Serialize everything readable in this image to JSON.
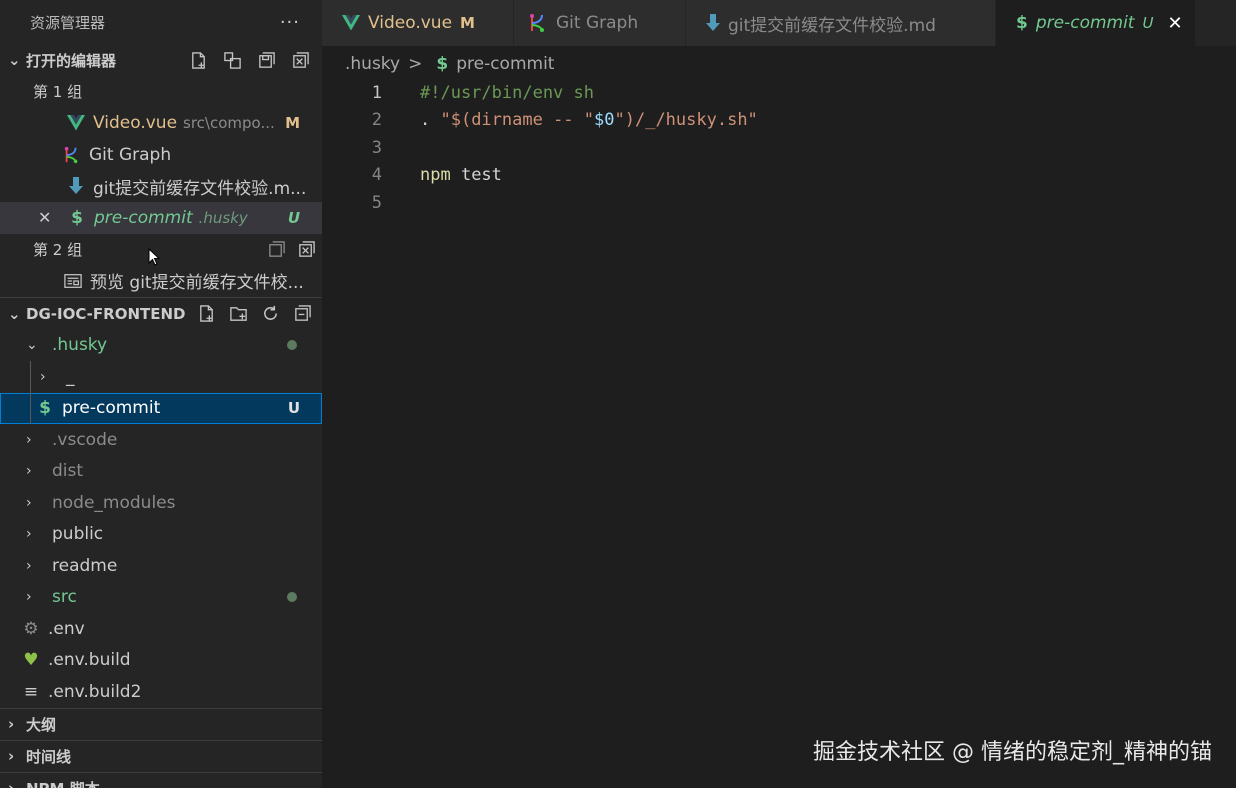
{
  "sidebar": {
    "title": "资源管理器",
    "more": "···",
    "open_editors": {
      "header": "打开的编辑器",
      "group1_label": "第 1 组",
      "group2_label": "第 2 组",
      "items": [
        {
          "label": "Video.vue",
          "desc": "src\\compo...",
          "badge": "M"
        },
        {
          "label": "Git Graph"
        },
        {
          "label": "git提交前缓存文件校验.m..."
        },
        {
          "label": "pre-commit",
          "desc": ".husky",
          "badge": "U",
          "close": "✕"
        }
      ],
      "group2_items": [
        {
          "label": "预览 git提交前缓存文件校..."
        }
      ]
    },
    "project": {
      "header": "DG-IOC-FRONTEND",
      "tree": [
        {
          "label": ".husky"
        },
        {
          "label": "_"
        },
        {
          "label": "pre-commit",
          "badge": "U"
        },
        {
          "label": ".vscode"
        },
        {
          "label": "dist"
        },
        {
          "label": "node_modules"
        },
        {
          "label": "public"
        },
        {
          "label": "readme"
        },
        {
          "label": "src"
        },
        {
          "label": ".env"
        },
        {
          "label": ".env.build"
        },
        {
          "label": ".env.build2"
        }
      ]
    },
    "outline": "大纲",
    "timeline": "时间线",
    "npm": "NPM 脚本"
  },
  "tabs": [
    {
      "label": "Video.vue",
      "mod": "M"
    },
    {
      "label": "Git Graph"
    },
    {
      "label": "git提交前缓存文件校验.md"
    },
    {
      "label": "pre-commit",
      "mod": "U",
      "close": "✕"
    }
  ],
  "breadcrumb": {
    "folder": ".husky",
    "sep": ">",
    "file": "pre-commit",
    "dollar": "$"
  },
  "editor": {
    "line_numbers": [
      "1",
      "2",
      "3",
      "4",
      "5"
    ],
    "line1": "#!/usr/bin/env sh",
    "line2_a": ". ",
    "line2_b": "\"$(dirname -- \"",
    "line2_c": "$0",
    "line2_d": "\")/_/husky.sh\"",
    "line4_a": "npm ",
    "line4_b": "test"
  },
  "watermark": "掘金技术社区 @ 情绪的稳定剂_精神的锚",
  "colors": {
    "vue_green": "#42b883",
    "modified": "#e2c08d",
    "untracked": "#73c991",
    "selection": "#04395e"
  }
}
